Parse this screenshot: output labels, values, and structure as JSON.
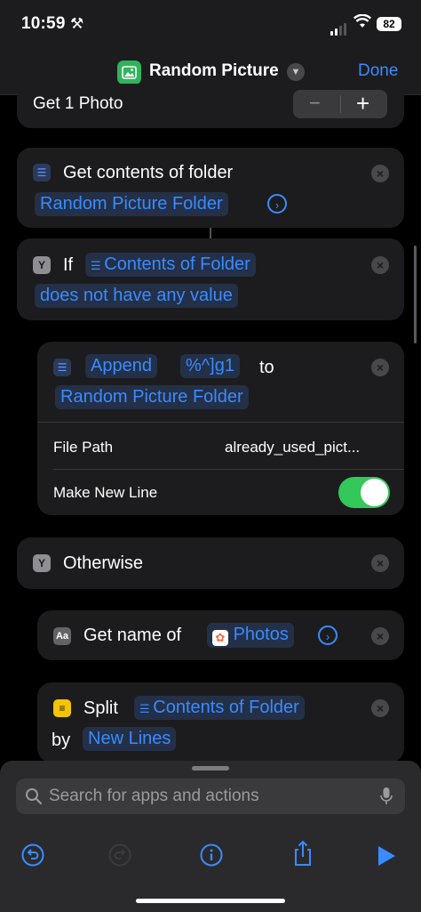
{
  "status": {
    "time": "10:59",
    "battery": "82"
  },
  "nav": {
    "title": "Random Picture",
    "done": "Done"
  },
  "actions": {
    "get_photo": {
      "label": "Get 1 Photo",
      "minus": "−",
      "plus": "+"
    },
    "get_folder": {
      "label": "Get contents of folder",
      "token": "Random Picture Folder"
    },
    "if": {
      "keyword": "If",
      "token": "Contents of Folder",
      "condition": "does not have any value"
    },
    "append": {
      "verb": "Append",
      "token_text": "%^]g1",
      "to": "to",
      "token_folder": "Random Picture Folder",
      "file_path_label": "File Path",
      "file_path_value": "already_used_pict...",
      "new_line_label": "Make New Line",
      "new_line_on": true
    },
    "otherwise": {
      "label": "Otherwise"
    },
    "get_name": {
      "label": "Get name of",
      "token": "Photos"
    },
    "split": {
      "verb": "Split",
      "token": "Contents of Folder",
      "by": "by",
      "token_by": "New Lines"
    }
  },
  "search": {
    "placeholder": "Search for apps and actions"
  },
  "colors": {
    "accent": "#3a8bff",
    "toggle_on": "#34c759",
    "card": "#1c1c1e"
  }
}
